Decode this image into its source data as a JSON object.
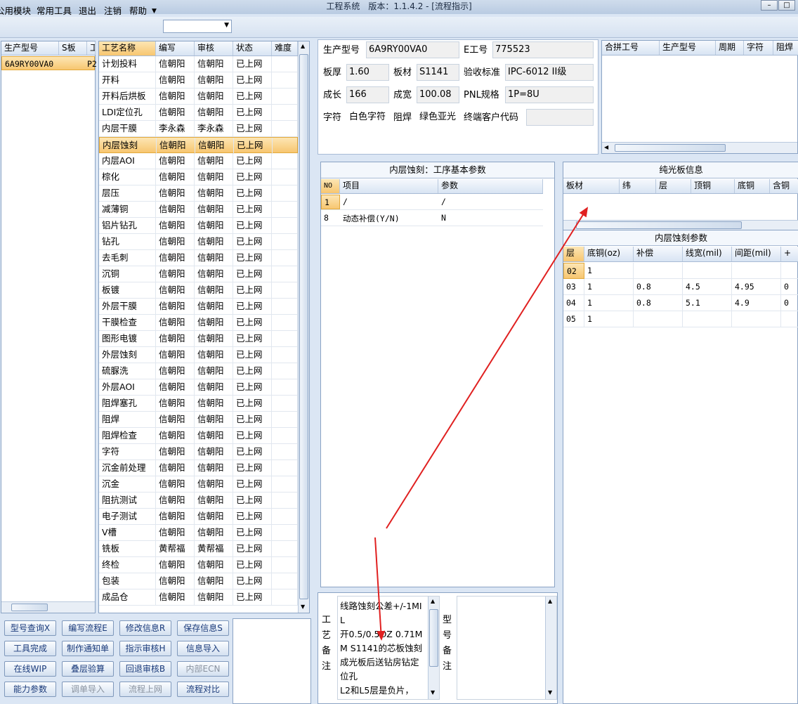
{
  "window": {
    "title": "工程系统　版本：1.1.4.2 - [流程指示]"
  },
  "menu": {
    "items": [
      "公用模块",
      "常用工具",
      "退出",
      "注销",
      "帮助"
    ],
    "combo_value": ""
  },
  "product_list": {
    "headers": [
      "生产型号",
      "S板",
      "工"
    ],
    "rows": [
      {
        "model": "6A9RY00VA0",
        "s": "P2"
      }
    ]
  },
  "process_grid": {
    "headers": [
      "工艺名称",
      "编写",
      "审核",
      "状态",
      "难度"
    ],
    "rows": [
      [
        "计划投料",
        "信朝阳",
        "信朝阳",
        "已上网"
      ],
      [
        "开料",
        "信朝阳",
        "信朝阳",
        "已上网"
      ],
      [
        "开料后烘板",
        "信朝阳",
        "信朝阳",
        "已上网"
      ],
      [
        "LDI定位孔",
        "信朝阳",
        "信朝阳",
        "已上网"
      ],
      [
        "内层干膜",
        "李永森",
        "李永森",
        "已上网"
      ],
      [
        "内层蚀刻",
        "信朝阳",
        "信朝阳",
        "已上网"
      ],
      [
        "内层AOI",
        "信朝阳",
        "信朝阳",
        "已上网"
      ],
      [
        "棕化",
        "信朝阳",
        "信朝阳",
        "已上网"
      ],
      [
        "层压",
        "信朝阳",
        "信朝阳",
        "已上网"
      ],
      [
        "减薄铜",
        "信朝阳",
        "信朝阳",
        "已上网"
      ],
      [
        "铝片钻孔",
        "信朝阳",
        "信朝阳",
        "已上网"
      ],
      [
        "钻孔",
        "信朝阳",
        "信朝阳",
        "已上网"
      ],
      [
        "去毛刺",
        "信朝阳",
        "信朝阳",
        "已上网"
      ],
      [
        "沉铜",
        "信朝阳",
        "信朝阳",
        "已上网"
      ],
      [
        "板镀",
        "信朝阳",
        "信朝阳",
        "已上网"
      ],
      [
        "外层干膜",
        "信朝阳",
        "信朝阳",
        "已上网"
      ],
      [
        "干膜检查",
        "信朝阳",
        "信朝阳",
        "已上网"
      ],
      [
        "图形电镀",
        "信朝阳",
        "信朝阳",
        "已上网"
      ],
      [
        "外层蚀刻",
        "信朝阳",
        "信朝阳",
        "已上网"
      ],
      [
        "硫脲洗",
        "信朝阳",
        "信朝阳",
        "已上网"
      ],
      [
        "外层AOI",
        "信朝阳",
        "信朝阳",
        "已上网"
      ],
      [
        "阻焊塞孔",
        "信朝阳",
        "信朝阳",
        "已上网"
      ],
      [
        "阻焊",
        "信朝阳",
        "信朝阳",
        "已上网"
      ],
      [
        "阻焊检查",
        "信朝阳",
        "信朝阳",
        "已上网"
      ],
      [
        "字符",
        "信朝阳",
        "信朝阳",
        "已上网"
      ],
      [
        "沉金前处理",
        "信朝阳",
        "信朝阳",
        "已上网"
      ],
      [
        "沉金",
        "信朝阳",
        "信朝阳",
        "已上网"
      ],
      [
        "阻抗测试",
        "信朝阳",
        "信朝阳",
        "已上网"
      ],
      [
        "电子测试",
        "信朝阳",
        "信朝阳",
        "已上网"
      ],
      [
        "V槽",
        "信朝阳",
        "信朝阳",
        "已上网"
      ],
      [
        "铣板",
        "黄帮福",
        "黄帮福",
        "已上网"
      ],
      [
        "终检",
        "信朝阳",
        "信朝阳",
        "已上网"
      ],
      [
        "包装",
        "信朝阳",
        "信朝阳",
        "已上网"
      ],
      [
        "成品仓",
        "信朝阳",
        "信朝阳",
        "已上网"
      ]
    ],
    "selected_index": 5
  },
  "info": {
    "model_label": "生产型号",
    "model_value": "6A9RY00VA0",
    "e_label": "E工号",
    "e_value": "775523",
    "thick_label": "板厚",
    "thick_value": "1.60",
    "material_label": "板材",
    "material_value": "S1141",
    "std_label": "验收标准",
    "std_value": "IPC-6012 II级",
    "len_label": "成长",
    "len_value": "166",
    "width_label": "成宽",
    "width_value": "100.08",
    "pnl_label": "PNL规格",
    "pnl_value": "1P=8U",
    "char_label": "字符",
    "char_value": "白色字符",
    "mask_label": "阻焊",
    "mask_value": "绿色亚光",
    "cust_label": "终端客户代码",
    "cust_value": ""
  },
  "merge_grid": {
    "headers": [
      "合拼工号",
      "生产型号",
      "周期",
      "字符",
      "阻焊"
    ]
  },
  "basic_params": {
    "title": "内层蚀刻：工序基本参数",
    "headers": [
      "NO",
      "项目",
      "参数"
    ],
    "rows": [
      [
        "1",
        "/",
        "/"
      ],
      [
        "8",
        "动态补偿(Y/N)",
        "N"
      ]
    ]
  },
  "bare_board": {
    "title": "纯光板信息",
    "headers": [
      "板材",
      "纬",
      "层",
      "顶铜",
      "底铜",
      "含铜"
    ]
  },
  "etch_params": {
    "title": "内层蚀刻参数",
    "headers": [
      "层",
      "底铜(oz)",
      "补偿",
      "线宽(mil)",
      "间距(mil)",
      "+"
    ],
    "rows": [
      [
        "02",
        "1",
        "",
        "",
        "",
        ""
      ],
      [
        "03",
        "1",
        "0.8",
        "4.5",
        "4.95",
        "0"
      ],
      [
        "04",
        "1",
        "0.8",
        "5.1",
        "4.9",
        "0"
      ],
      [
        "05",
        "1",
        "",
        "",
        "",
        ""
      ]
    ]
  },
  "remarks": {
    "process_label": "工艺备注",
    "process_text": "线路蚀刻公差+/-1MIL\n开0.5/0.5OZ 0.71MM S1141的芯板蚀刻成光板后送钻房钻定位孔\nL2和L5层是负片，",
    "model_label": "型号备注",
    "model_text": ""
  },
  "buttons": [
    {
      "label": "型号查询X",
      "enabled": true
    },
    {
      "label": "编写流程E",
      "enabled": true
    },
    {
      "label": "修改信息R",
      "enabled": true
    },
    {
      "label": "保存信息S",
      "enabled": true
    },
    {
      "label": "工具完成",
      "enabled": true
    },
    {
      "label": "制作通知单",
      "enabled": true
    },
    {
      "label": "指示审核H",
      "enabled": true
    },
    {
      "label": "信息导入",
      "enabled": true
    },
    {
      "label": "在线WIP",
      "enabled": true
    },
    {
      "label": "叠层验算",
      "enabled": true
    },
    {
      "label": "回退审核B",
      "enabled": true
    },
    {
      "label": "内部ECN",
      "enabled": false
    },
    {
      "label": "能力参数",
      "enabled": true
    },
    {
      "label": "调单导入",
      "enabled": false
    },
    {
      "label": "流程上网",
      "enabled": false
    },
    {
      "label": "流程对比",
      "enabled": true
    }
  ],
  "colors": {
    "accent": "#f7c670",
    "annotation_arrow": "#e02020"
  }
}
